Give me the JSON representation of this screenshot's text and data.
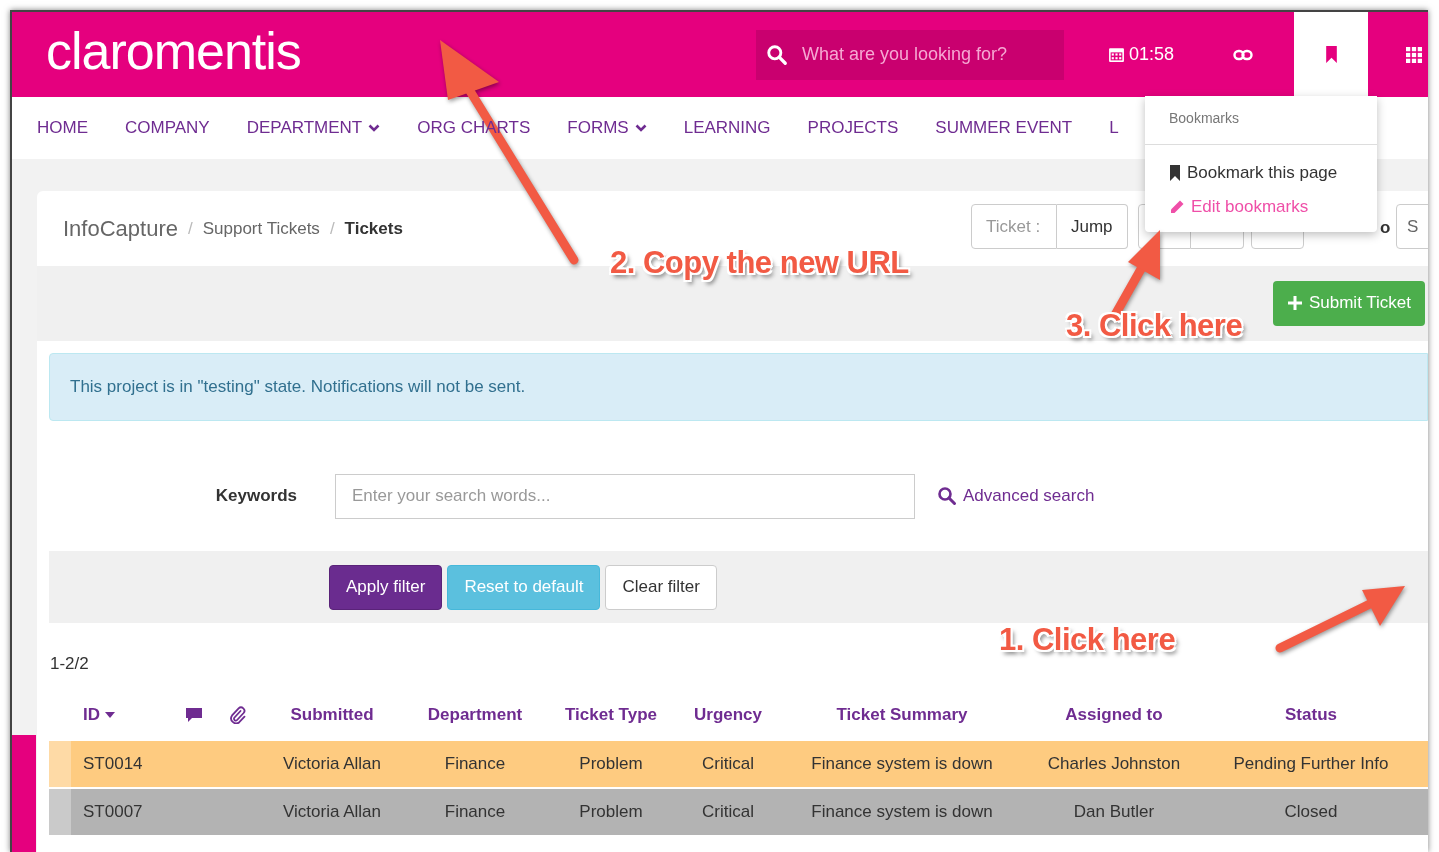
{
  "header": {
    "logo": "claromentis",
    "search": {
      "placeholder": "What are you looking for?"
    },
    "tools": [
      {
        "kind": "clock",
        "label": "01:58",
        "selected": false
      },
      {
        "kind": "link",
        "selected": false
      },
      {
        "kind": "bookmark",
        "selected": true
      },
      {
        "kind": "apps",
        "selected": false
      }
    ]
  },
  "nav": [
    {
      "label": "HOME",
      "dropdown": false
    },
    {
      "label": "COMPANY",
      "dropdown": false
    },
    {
      "label": "DEPARTMENT",
      "dropdown": true
    },
    {
      "label": "ORG CHARTS",
      "dropdown": false
    },
    {
      "label": "FORMS",
      "dropdown": true
    },
    {
      "label": "LEARNING",
      "dropdown": false
    },
    {
      "label": "PROJECTS",
      "dropdown": false
    },
    {
      "label": "SUMMER EVENT",
      "dropdown": false
    },
    {
      "label": "L",
      "dropdown": false
    }
  ],
  "bookmarks_menu": {
    "title": "Bookmarks",
    "items": [
      {
        "kind": "bookmark",
        "label": "Bookmark this page"
      },
      {
        "kind": "edit",
        "label": "Edit bookmarks"
      }
    ]
  },
  "breadcrumb": [
    {
      "kind": "root",
      "label": "InfoCapture"
    },
    {
      "kind": "separator",
      "label": "/"
    },
    {
      "kind": "link",
      "label": "Support Tickets"
    },
    {
      "kind": "separator",
      "label": "/"
    },
    {
      "kind": "current",
      "label": "Tickets"
    }
  ],
  "jump": {
    "placeholder": "Ticket :",
    "button": "Jump"
  },
  "to_label": "o",
  "to_field": "S",
  "submit_button": "Submit Ticket",
  "alert": "This project is in \"testing\" state. Notifications will not be sent.",
  "filter": {
    "label": "Keywords",
    "placeholder": "Enter your search words...",
    "advanced": "Advanced search",
    "buttons": [
      {
        "kind": "primary",
        "label": "Apply filter"
      },
      {
        "kind": "info",
        "label": "Reset to default"
      },
      {
        "kind": "default",
        "label": "Clear filter"
      }
    ]
  },
  "count": "1-2/2",
  "table": {
    "columns": [
      {
        "kind": "text",
        "label": "ID",
        "sorted": true
      },
      {
        "kind": "comments"
      },
      {
        "kind": "attachments"
      },
      {
        "kind": "text",
        "label": "Submitted",
        "sorted": false
      },
      {
        "kind": "text",
        "label": "Department",
        "sorted": false
      },
      {
        "kind": "text",
        "label": "Ticket Type",
        "sorted": false
      },
      {
        "kind": "text",
        "label": "Urgency",
        "sorted": false
      },
      {
        "kind": "text",
        "label": "Ticket Summary",
        "sorted": false
      },
      {
        "kind": "text",
        "label": "Assigned to",
        "sorted": false
      },
      {
        "kind": "text",
        "label": "Status",
        "sorted": false
      }
    ],
    "rows": [
      {
        "color": "#fecb80",
        "cells": [
          "ST0014",
          "",
          "",
          "Victoria Allan",
          "Finance",
          "Problem",
          "Critical",
          "Finance system is down",
          "Charles Johnston",
          "Pending Further Info"
        ]
      },
      {
        "color": "#b3b3b3",
        "cells": [
          "ST0007",
          "",
          "",
          "Victoria Allan",
          "Finance",
          "Problem",
          "Critical",
          "Finance system is down",
          "Dan Butler",
          "Closed"
        ]
      }
    ]
  },
  "annotations": [
    {
      "label": "2. Copy the new URL"
    },
    {
      "label": "3. Click here"
    },
    {
      "label": "1. Click here"
    }
  ]
}
